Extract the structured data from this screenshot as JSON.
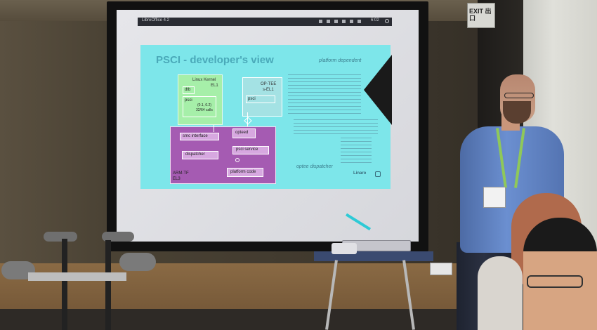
{
  "exit_sign": "EXIT 出口",
  "desktop_bar": {
    "title": "LibreOffice 4.2",
    "time": "6:02"
  },
  "slide": {
    "title": "PSCI - developer's view",
    "platform_dependent": "platform dependent",
    "linux_kernel": "Linux Kernel",
    "linux_el": "EL1",
    "dtb": "dtb",
    "psci": "psci",
    "psci_version": "(0.1, 0.2)",
    "psci_calls": "32/64 calls",
    "optee": "OP-TEE",
    "optee_el": "s-EL1",
    "optee_psci": "psci",
    "smc_interface": "smc interface",
    "opteed": "opteed",
    "dispatcher": "dispatcher",
    "psci_service": "psci service",
    "platform_code": "platform code",
    "armtf": "ARM-TF",
    "armtf_el": "EL3",
    "optee_dispatcher": "optee dispatcher",
    "linaro_logo": "Linaro",
    "nav_arrow": "▶"
  },
  "colors": {
    "slide_bg": "#78e6ea",
    "linux_box": "#a6efa9",
    "armtf_box": "#a55bb2",
    "optee_box": "#a4e2e4",
    "screen": "#e8e8ec"
  }
}
